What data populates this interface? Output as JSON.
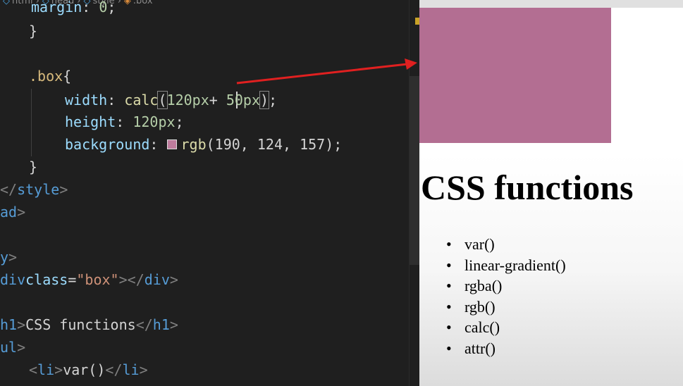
{
  "breadcrumb": {
    "items": [
      "html",
      "head",
      "style",
      ".box"
    ]
  },
  "editor": {
    "lines": [
      {
        "parts": [
          {
            "t": "    ",
            "c": "text"
          },
          {
            "t": "margin",
            "c": "prop"
          },
          {
            "t": ": ",
            "c": "text"
          },
          {
            "t": "0",
            "c": "num"
          },
          {
            "t": ";",
            "c": "text"
          }
        ]
      },
      {
        "parts": [
          {
            "t": "  }",
            "c": "text"
          }
        ]
      },
      {
        "parts": []
      },
      {
        "parts": [
          {
            "t": "  ",
            "c": "text"
          },
          {
            "t": ".box",
            "c": "sel"
          },
          {
            "t": " {",
            "c": "text"
          }
        ]
      },
      {
        "parts": [
          {
            "t": "    ",
            "c": "text"
          },
          {
            "t": "width",
            "c": "prop"
          },
          {
            "t": ": ",
            "c": "text"
          },
          {
            "t": "calc",
            "c": "fn"
          },
          {
            "t": "(",
            "c": "bracket"
          },
          {
            "t": "120px",
            "c": "num"
          },
          {
            "t": " + ",
            "c": "text"
          },
          {
            "t": "50px",
            "c": "num"
          },
          {
            "t": ")",
            "c": "bracket"
          },
          {
            "t": ";",
            "c": "text"
          }
        ]
      },
      {
        "parts": [
          {
            "t": "    ",
            "c": "text"
          },
          {
            "t": "height",
            "c": "prop"
          },
          {
            "t": ": ",
            "c": "text"
          },
          {
            "t": "120px",
            "c": "num"
          },
          {
            "t": ";",
            "c": "text"
          }
        ]
      },
      {
        "parts": [
          {
            "t": "    ",
            "c": "text"
          },
          {
            "t": "background",
            "c": "prop"
          },
          {
            "t": ": ",
            "c": "text"
          },
          {
            "t": "",
            "c": "swatch"
          },
          {
            "t": "rgb",
            "c": "fn"
          },
          {
            "t": "(190, 124, 157)",
            "c": "text"
          },
          {
            "t": ";",
            "c": "text"
          }
        ]
      },
      {
        "parts": [
          {
            "t": "  }",
            "c": "text"
          }
        ]
      },
      {
        "parts": [
          {
            "t": "</",
            "c": "punct"
          },
          {
            "t": "style",
            "c": "tag"
          },
          {
            "t": ">",
            "c": "punct"
          }
        ]
      },
      {
        "parts": [
          {
            "t": "ad",
            "c": "tag"
          },
          {
            "t": ">",
            "c": "punct"
          }
        ]
      },
      {
        "parts": []
      },
      {
        "parts": [
          {
            "t": "y",
            "c": "tag"
          },
          {
            "t": ">",
            "c": "punct"
          }
        ]
      },
      {
        "parts": [
          {
            "t": "div",
            "c": "tag"
          },
          {
            "t": " ",
            "c": "text"
          },
          {
            "t": "class",
            "c": "attr"
          },
          {
            "t": "=",
            "c": "text"
          },
          {
            "t": "\"box\"",
            "c": "str"
          },
          {
            "t": "></",
            "c": "punct"
          },
          {
            "t": "div",
            "c": "tag"
          },
          {
            "t": ">",
            "c": "punct"
          }
        ]
      },
      {
        "parts": []
      },
      {
        "parts": [
          {
            "t": "h1",
            "c": "tag"
          },
          {
            "t": ">",
            "c": "punct"
          },
          {
            "t": "CSS functions",
            "c": "text"
          },
          {
            "t": "</",
            "c": "punct"
          },
          {
            "t": "h1",
            "c": "tag"
          },
          {
            "t": ">",
            "c": "punct"
          }
        ]
      },
      {
        "parts": [
          {
            "t": "ul",
            "c": "tag"
          },
          {
            "t": ">",
            "c": "punct"
          }
        ]
      },
      {
        "parts": [
          {
            "t": "  ",
            "c": "text"
          },
          {
            "t": "<",
            "c": "punct"
          },
          {
            "t": "li",
            "c": "tag"
          },
          {
            "t": ">",
            "c": "punct"
          },
          {
            "t": "var()",
            "c": "text"
          },
          {
            "t": "</",
            "c": "punct"
          },
          {
            "t": "li",
            "c": "tag"
          },
          {
            "t": ">",
            "c": "punct"
          }
        ]
      }
    ],
    "swatch_color": "#be7c9d"
  },
  "preview": {
    "box_color": "#b36e92",
    "heading": "CSS functions",
    "list_items": [
      "var()",
      "linear-gradient()",
      "rgba()",
      "rgb()",
      "calc()",
      "attr()"
    ]
  },
  "colors": {
    "arrow": "#e02020"
  }
}
